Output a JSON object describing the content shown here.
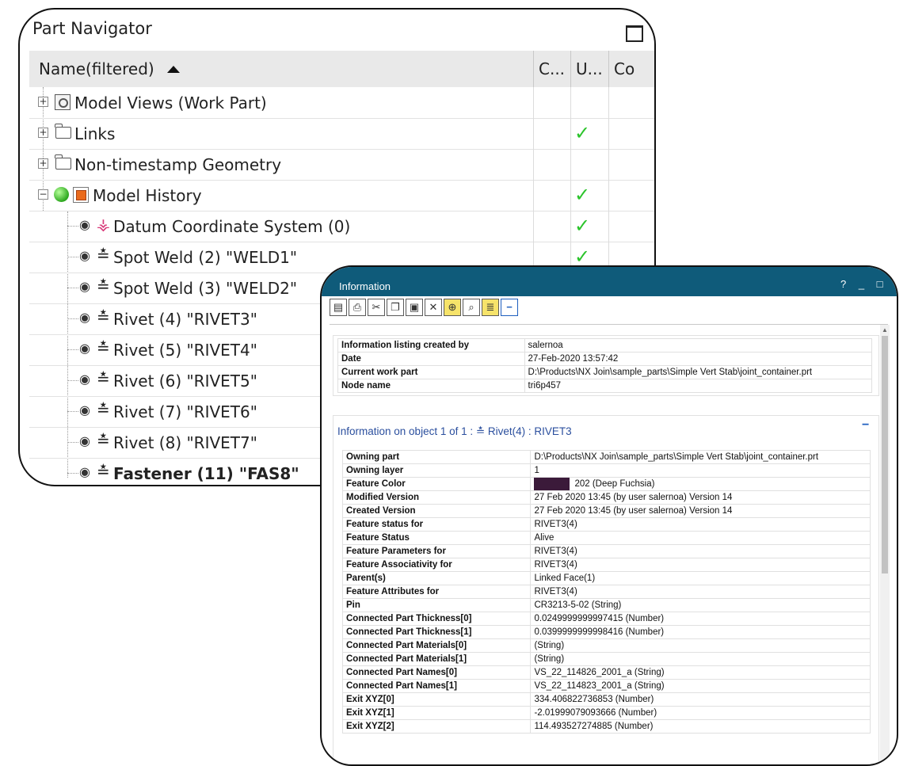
{
  "navigator": {
    "title": "Part Navigator",
    "columns": [
      "Name(filtered)",
      "C...",
      "U...",
      "Co"
    ],
    "rows": [
      {
        "label": "Model Views (Work Part)",
        "checked": false
      },
      {
        "label": "Links",
        "checked": true
      },
      {
        "label": "Non-timestamp Geometry",
        "checked": false
      },
      {
        "label": "Model History",
        "checked": true
      },
      {
        "label": "Datum Coordinate System (0)",
        "checked": true
      },
      {
        "label": "Spot Weld (2) \"WELD1\"",
        "checked": true
      },
      {
        "label": "Spot Weld (3) \"WELD2\"",
        "checked": false
      },
      {
        "label": "Rivet (4) \"RIVET3\"",
        "checked": false
      },
      {
        "label": "Rivet (5) \"RIVET4\"",
        "checked": false
      },
      {
        "label": "Rivet (6) \"RIVET5\"",
        "checked": false
      },
      {
        "label": "Rivet (7) \"RIVET6\"",
        "checked": false
      },
      {
        "label": "Rivet (8) \"RIVET7\"",
        "checked": false
      },
      {
        "label": "Fastener (11) \"FAS8\"",
        "checked": false
      }
    ],
    "check_glyph": "✓",
    "expander_plus": "+",
    "expander_minus": "−"
  },
  "info": {
    "title": "Information",
    "controls": "? _ □",
    "summary": [
      {
        "key": "Information listing created by",
        "value": "salernoa"
      },
      {
        "key": "Date",
        "value": "27-Feb-2020 13:57:42"
      },
      {
        "key": "Current work part",
        "value": "D:\\Products\\NX Join\\sample_parts\\Simple Vert Stab\\joint_container.prt"
      },
      {
        "key": "Node name",
        "value": "tri6p457"
      }
    ],
    "object_heading": "Information on object 1 of 1 : ≛ Rivet(4) : RIVET3",
    "feature_color_hex": "#3b1a3a",
    "details": [
      {
        "key": "Owning part",
        "value": "D:\\Products\\NX Join\\sample_parts\\Simple Vert Stab\\joint_container.prt"
      },
      {
        "key": "Owning layer",
        "value": "1"
      },
      {
        "key": "Feature Color",
        "value": "202 (Deep Fuchsia)"
      },
      {
        "key": "Modified Version",
        "value": "27 Feb 2020 13:45 (by user salernoa) Version 14"
      },
      {
        "key": "Created Version",
        "value": "27 Feb 2020 13:45 (by user salernoa) Version 14"
      },
      {
        "key": "Feature status for",
        "value": "RIVET3(4)"
      },
      {
        "key": "Feature Status",
        "value": "Alive"
      },
      {
        "key": "Feature Parameters for",
        "value": "RIVET3(4)"
      },
      {
        "key": "Feature Associativity for",
        "value": "RIVET3(4)"
      },
      {
        "key": "Parent(s)",
        "value": "Linked Face(1)"
      },
      {
        "key": "Feature Attributes for",
        "value": "RIVET3(4)"
      },
      {
        "key": "Pin",
        "value": "CR3213-5-02 (String)"
      },
      {
        "key": "Connected Part Thickness[0]",
        "value": "0.0249999999997415 (Number)"
      },
      {
        "key": "Connected Part Thickness[1]",
        "value": "0.0399999999998416 (Number)"
      },
      {
        "key": "Connected Part Materials[0]",
        "value": "(String)"
      },
      {
        "key": "Connected Part Materials[1]",
        "value": "(String)"
      },
      {
        "key": "Connected Part Names[0]",
        "value": "VS_22_114826_2001_a (String)"
      },
      {
        "key": "Connected Part Names[1]",
        "value": "VS_22_114823_2001_a (String)"
      },
      {
        "key": "Exit XYZ[0]",
        "value": "334.406822736853 (Number)"
      },
      {
        "key": "Exit XYZ[1]",
        "value": "-2.01999079093666 (Number)"
      },
      {
        "key": "Exit XYZ[2]",
        "value": "114.493527274885 (Number)"
      }
    ]
  }
}
